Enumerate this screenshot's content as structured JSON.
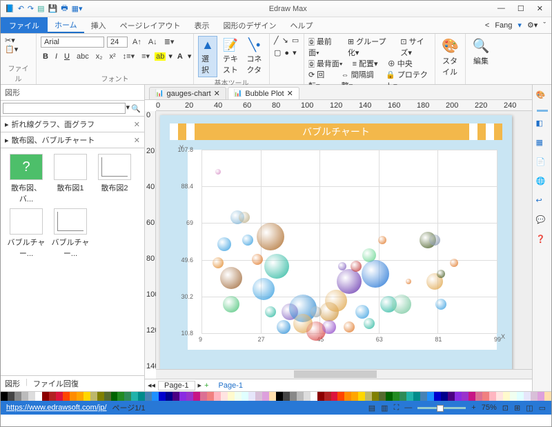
{
  "app_title": "Edraw Max",
  "window": {
    "min": "—",
    "max": "☐",
    "close": "✕"
  },
  "user": "Fang",
  "menu": {
    "file": "ファイル",
    "tabs": [
      "ホーム",
      "挿入",
      "ページレイアウト",
      "表示",
      "図形のデザイン",
      "ヘルプ"
    ]
  },
  "ribbon": {
    "file_lbl": "ファイル",
    "font_lbl": "フォント",
    "font_name": "Arial",
    "font_size": "24",
    "tools_lbl": "基本ツール",
    "select": "選択",
    "text": "テキスト",
    "connector": "コネクタ",
    "arrange_lbl": "配置",
    "front": "最前面",
    "back": "最背面",
    "rotate": "回転",
    "group": "グループ化",
    "align": "配置",
    "spacing": "間隔調整",
    "size": "サイズ",
    "center": "中央",
    "protect": "プロテクト",
    "style": "スタイル",
    "edit": "編集"
  },
  "shapes": {
    "title": "図形",
    "search_ph": "",
    "cat1": "折れ線グラフ、面グラフ",
    "cat2": "散布図、バブルチャート",
    "items": [
      "散布図、バ...",
      "散布図1",
      "散布図2",
      "バブルチャー...",
      "バブルチャー..."
    ]
  },
  "panefoot": {
    "a": "図形",
    "b": "ファイル回復"
  },
  "doctabs": [
    {
      "label": "gauges-chart"
    },
    {
      "label": "Bubble Plot"
    }
  ],
  "ruler_h": [
    "0",
    "20",
    "40",
    "60",
    "80",
    "100",
    "120",
    "140",
    "160",
    "180",
    "200",
    "220",
    "240"
  ],
  "ruler_v": [
    "0",
    "20",
    "40",
    "60",
    "80",
    "100",
    "120",
    "140"
  ],
  "chart_data": {
    "type": "scatter",
    "title": "バブルチャート",
    "xlabel": "X",
    "ylabel": "Y",
    "xlim": [
      9,
      99
    ],
    "ylim": [
      10.8,
      107.8
    ],
    "xticks": [
      9,
      27,
      45,
      63,
      81,
      99
    ],
    "yticks": [
      10.8,
      30.2,
      49.6,
      69,
      88.4,
      107.8
    ],
    "bubbles": [
      {
        "x": 14,
        "y": 96,
        "r": 4,
        "c": "#d58bc4"
      },
      {
        "x": 16,
        "y": 58,
        "r": 10,
        "c": "#3aa0e0"
      },
      {
        "x": 14,
        "y": 48,
        "r": 8,
        "c": "#e28b2d"
      },
      {
        "x": 18,
        "y": 40,
        "r": 16,
        "c": "#a16a3a"
      },
      {
        "x": 18,
        "y": 26,
        "r": 12,
        "c": "#4dc47a"
      },
      {
        "x": 20,
        "y": 72,
        "r": 10,
        "c": "#7fb4d6"
      },
      {
        "x": 22,
        "y": 72,
        "r": 8,
        "c": "#bdb08a"
      },
      {
        "x": 23,
        "y": 60,
        "r": 8,
        "c": "#3aa0e0"
      },
      {
        "x": 26,
        "y": 50,
        "r": 8,
        "c": "#e07828"
      },
      {
        "x": 28,
        "y": 34,
        "r": 16,
        "c": "#3aa0e0"
      },
      {
        "x": 30,
        "y": 62,
        "r": 20,
        "c": "#b07030"
      },
      {
        "x": 32,
        "y": 46,
        "r": 18,
        "c": "#2bb8a0"
      },
      {
        "x": 30,
        "y": 22,
        "r": 8,
        "c": "#2bb8a0"
      },
      {
        "x": 36,
        "y": 22,
        "r": 12,
        "c": "#8260c0"
      },
      {
        "x": 34,
        "y": 14,
        "r": 10,
        "c": "#2b90d8"
      },
      {
        "x": 40,
        "y": 24,
        "r": 20,
        "c": "#2b88d0"
      },
      {
        "x": 40,
        "y": 16,
        "r": 14,
        "c": "#e0a850"
      },
      {
        "x": 44,
        "y": 12,
        "r": 14,
        "c": "#d94848"
      },
      {
        "x": 44,
        "y": 22,
        "r": 8,
        "c": "#a0a8a8"
      },
      {
        "x": 48,
        "y": 22,
        "r": 14,
        "c": "#d09840"
      },
      {
        "x": 48,
        "y": 14,
        "r": 10,
        "c": "#9048c8"
      },
      {
        "x": 50,
        "y": 28,
        "r": 16,
        "c": "#e0a850"
      },
      {
        "x": 52,
        "y": 46,
        "r": 6,
        "c": "#8260c0"
      },
      {
        "x": 54,
        "y": 38,
        "r": 18,
        "c": "#6a3ab0"
      },
      {
        "x": 54,
        "y": 14,
        "r": 8,
        "c": "#e07828"
      },
      {
        "x": 56,
        "y": 46,
        "r": 8,
        "c": "#c03838"
      },
      {
        "x": 60,
        "y": 52,
        "r": 10,
        "c": "#68d690"
      },
      {
        "x": 62,
        "y": 42,
        "r": 20,
        "c": "#2878d6"
      },
      {
        "x": 58,
        "y": 22,
        "r": 10,
        "c": "#3aa0e0"
      },
      {
        "x": 60,
        "y": 16,
        "r": 8,
        "c": "#2bb8a0"
      },
      {
        "x": 64,
        "y": 60,
        "r": 6,
        "c": "#e07828"
      },
      {
        "x": 66,
        "y": 26,
        "r": 12,
        "c": "#2bb8a0"
      },
      {
        "x": 70,
        "y": 26,
        "r": 14,
        "c": "#78c8a0"
      },
      {
        "x": 72,
        "y": 38,
        "r": 4,
        "c": "#e07828"
      },
      {
        "x": 78,
        "y": 60,
        "r": 12,
        "c": "#4a6028"
      },
      {
        "x": 80,
        "y": 60,
        "r": 8,
        "c": "#8898b0"
      },
      {
        "x": 80,
        "y": 38,
        "r": 12,
        "c": "#e0a850"
      },
      {
        "x": 82,
        "y": 42,
        "r": 6,
        "c": "#4a6028"
      },
      {
        "x": 82,
        "y": 26,
        "r": 8,
        "c": "#3aa0e0"
      },
      {
        "x": 86,
        "y": 48,
        "r": 6,
        "c": "#e07828"
      }
    ]
  },
  "pages": {
    "tab": "Page-1",
    "list": "Page-1",
    "add": "+"
  },
  "status": {
    "url": "https://www.edrawsoft.com/jp/",
    "page": "ページ1/1",
    "zoom": "75%"
  },
  "palette": [
    "#000",
    "#444",
    "#888",
    "#bbb",
    "#ddd",
    "#fff",
    "#8b0000",
    "#b22222",
    "#dc143c",
    "#ff4500",
    "#ff8c00",
    "#ffa500",
    "#ffd700",
    "#bdb76b",
    "#808000",
    "#556b2f",
    "#006400",
    "#228b22",
    "#2e8b57",
    "#20b2aa",
    "#008b8b",
    "#4682b4",
    "#1e90ff",
    "#0000cd",
    "#00008b",
    "#4b0082",
    "#8a2be2",
    "#9932cc",
    "#c71585",
    "#db7093",
    "#f08080",
    "#ffb6c1",
    "#ffe4e1",
    "#fffacd",
    "#f0fff0",
    "#e0ffff",
    "#e6e6fa",
    "#d8bfd8",
    "#dda0dd",
    "#ffdead"
  ]
}
